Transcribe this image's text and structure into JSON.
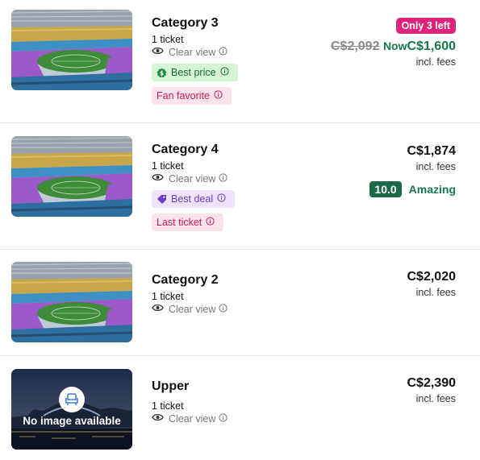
{
  "listings": [
    {
      "title": "Category 3",
      "tickets": "1 ticket",
      "view": "Clear view",
      "badges": [
        "Best price",
        "Fan favorite"
      ],
      "urgency": "Only 3 left",
      "old_price": "C$2,092",
      "now_label": "Now",
      "price": "C$1,600",
      "fees": "incl. fees",
      "image": "stadium-photo"
    },
    {
      "title": "Category 4",
      "tickets": "1 ticket",
      "view": "Clear view",
      "badges": [
        "Best deal",
        "Last ticket"
      ],
      "price": "C$1,874",
      "fees": "incl. fees",
      "rating_score": "10.0",
      "rating_label": "Amazing",
      "image": "stadium-photo"
    },
    {
      "title": "Category 2",
      "tickets": "1 ticket",
      "view": "Clear view",
      "price": "C$2,020",
      "fees": "incl. fees",
      "image": "stadium-photo"
    },
    {
      "title": "Upper",
      "tickets": "1 ticket",
      "view": "Clear view",
      "price": "C$2,390",
      "fees": "incl. fees",
      "image": "no-image",
      "no_image_text": "No image available"
    }
  ],
  "icons": {
    "view": "eye-icon",
    "info": "info-icon",
    "best_price": "dollar-tag-icon",
    "best_deal": "price-tag-icon",
    "no_image": "seat-icon"
  },
  "colors": {
    "urgency": "#e0237a",
    "price_now": "#16794a",
    "rating_bg": "#1a6b45",
    "best_price_bg": "#d5f5d6",
    "best_deal_bg": "#efe3fc",
    "pink_badge_bg": "#fde4ec"
  }
}
